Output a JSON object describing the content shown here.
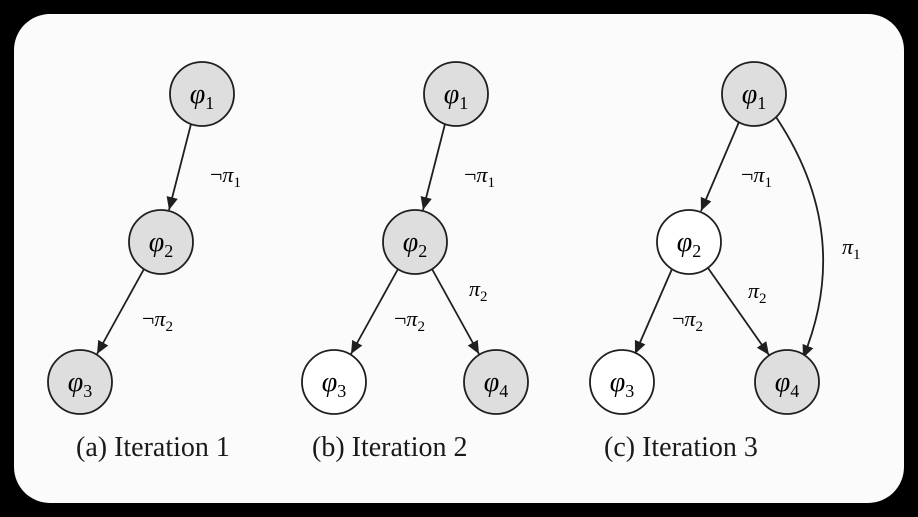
{
  "chart_data": [
    {
      "type": "graph",
      "title": "(a) Iteration 1",
      "nodes": [
        {
          "id": "phi1",
          "label": "φ₁",
          "filled": true
        },
        {
          "id": "phi2",
          "label": "φ₂",
          "filled": true
        },
        {
          "id": "phi3",
          "label": "φ₃",
          "filled": true
        }
      ],
      "edges": [
        {
          "from": "phi1",
          "to": "phi2",
          "label": "¬π₁"
        },
        {
          "from": "phi2",
          "to": "phi3",
          "label": "¬π₂"
        }
      ]
    },
    {
      "type": "graph",
      "title": "(b) Iteration 2",
      "nodes": [
        {
          "id": "phi1",
          "label": "φ₁",
          "filled": true
        },
        {
          "id": "phi2",
          "label": "φ₂",
          "filled": true
        },
        {
          "id": "phi3",
          "label": "φ₃",
          "filled": false
        },
        {
          "id": "phi4",
          "label": "φ₄",
          "filled": true
        }
      ],
      "edges": [
        {
          "from": "phi1",
          "to": "phi2",
          "label": "¬π₁"
        },
        {
          "from": "phi2",
          "to": "phi3",
          "label": "¬π₂"
        },
        {
          "from": "phi2",
          "to": "phi4",
          "label": "π₂"
        }
      ]
    },
    {
      "type": "graph",
      "title": "(c) Iteration 3",
      "nodes": [
        {
          "id": "phi1",
          "label": "φ₁",
          "filled": true
        },
        {
          "id": "phi2",
          "label": "φ₂",
          "filled": false
        },
        {
          "id": "phi3",
          "label": "φ₃",
          "filled": false
        },
        {
          "id": "phi4",
          "label": "φ₄",
          "filled": true
        }
      ],
      "edges": [
        {
          "from": "phi1",
          "to": "phi2",
          "label": "¬π₁"
        },
        {
          "from": "phi2",
          "to": "phi3",
          "label": "¬π₂"
        },
        {
          "from": "phi2",
          "to": "phi4",
          "label": "π₂"
        },
        {
          "from": "phi1",
          "to": "phi4",
          "label": "π₁"
        }
      ]
    }
  ],
  "colors": {
    "node_fill": "#dedede",
    "node_empty": "#ffffff",
    "stroke": "#1f1f1f",
    "bg": "#fbfbfb"
  },
  "symbols": {
    "phi": "φ",
    "pi": "π",
    "neg": "¬"
  },
  "captions": {
    "a": "(a) Iteration 1",
    "b": "(b) Iteration 2",
    "c": "(c) Iteration 3"
  },
  "labels": {
    "phi1_base": "φ",
    "phi1_sub": "1",
    "phi2_base": "φ",
    "phi2_sub": "2",
    "phi3_base": "φ",
    "phi3_sub": "3",
    "phi4_base": "φ",
    "phi4_sub": "4",
    "neg": "¬",
    "pi": "π",
    "pi1_sub": "1",
    "pi2_sub": "2"
  }
}
